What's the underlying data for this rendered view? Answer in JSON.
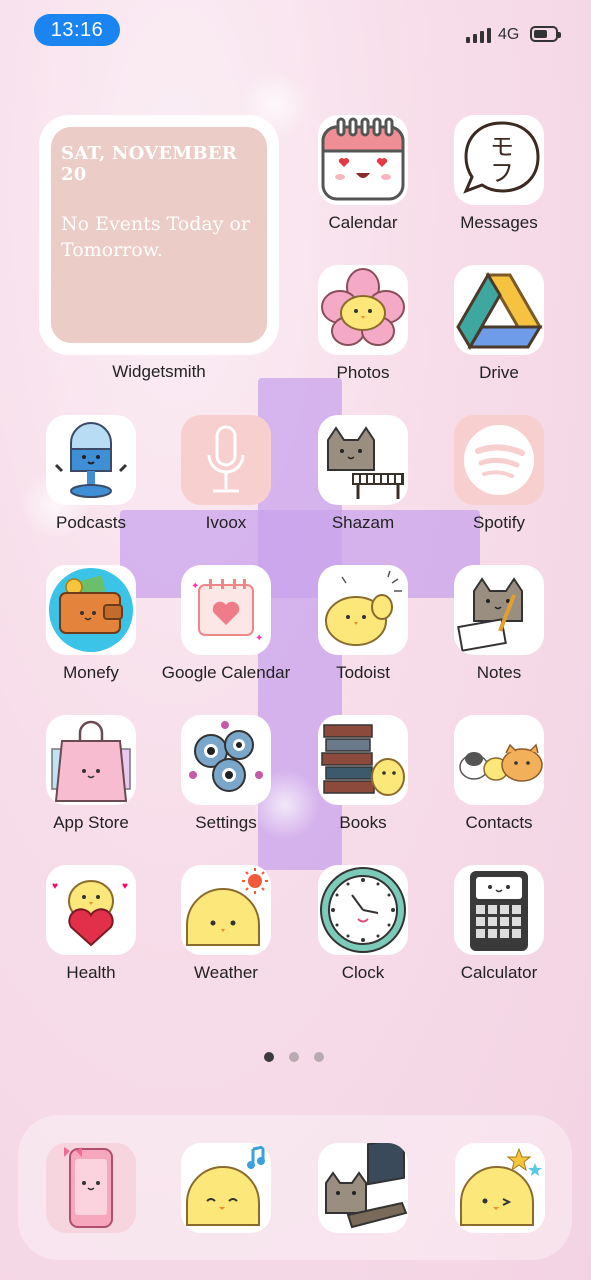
{
  "status_bar": {
    "time": "13:16",
    "network": "4G"
  },
  "widget": {
    "date": "SAT, NOVEMBER 20",
    "events": "No Events Today or Tomorrow.",
    "label": "Widgetsmith"
  },
  "apps": [
    {
      "label": "Calendar"
    },
    {
      "label": "Messages"
    },
    {
      "label": "Photos"
    },
    {
      "label": "Drive"
    },
    {
      "label": "Podcasts"
    },
    {
      "label": "Ivoox"
    },
    {
      "label": "Shazam"
    },
    {
      "label": "Spotify"
    },
    {
      "label": "Monefy"
    },
    {
      "label": "Google Calendar"
    },
    {
      "label": "Todoist"
    },
    {
      "label": "Notes"
    },
    {
      "label": "App Store"
    },
    {
      "label": "Settings"
    },
    {
      "label": "Books"
    },
    {
      "label": "Contacts"
    },
    {
      "label": "Health"
    },
    {
      "label": "Weather"
    },
    {
      "label": "Clock"
    },
    {
      "label": "Calculator"
    }
  ],
  "messages_icon_text": "モフ",
  "page_indicator": {
    "pages": 3,
    "current": 1
  },
  "colors": {
    "time_pill": "#1a84f0",
    "background": "#f7dde9",
    "cross": "#c9a3ec",
    "widget": "#ecccc6"
  }
}
